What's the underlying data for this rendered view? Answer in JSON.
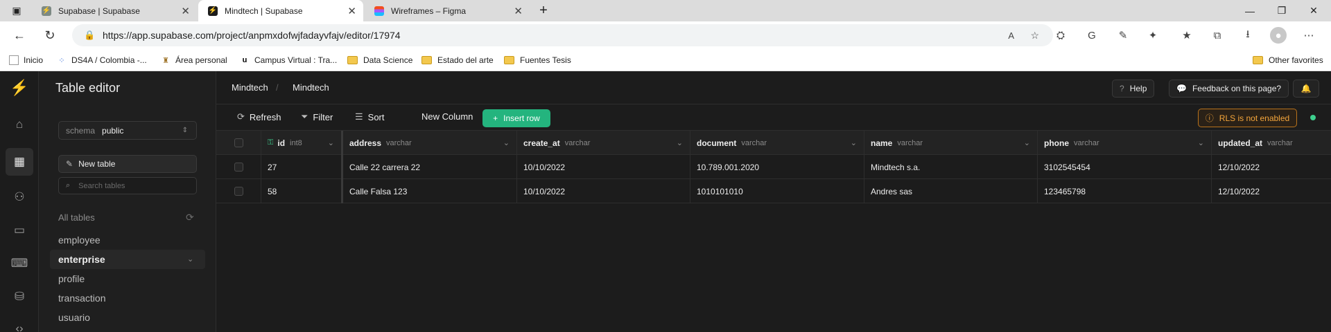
{
  "browser": {
    "tabs": [
      {
        "title": "Supabase | Supabase",
        "icon": "supabase-icon"
      },
      {
        "title": "Mindtech | Supabase",
        "icon": "supabase-icon"
      },
      {
        "title": "Wireframes – Figma",
        "icon": "figma-icon"
      }
    ],
    "url": "https://app.supabase.com/project/anpmxdofwjfadayvfajv/editor/17974",
    "bookmarks": [
      "Inicio",
      "DS4A / Colombia -...",
      "Área personal",
      "Campus Virtual : Tra...",
      "Data Science",
      "Estado del arte",
      "Fuentes Tesis"
    ],
    "other_favorites": "Other favorites"
  },
  "sidebar": {
    "title": "Table editor",
    "schema_label": "schema",
    "schema_value": "public",
    "new_table": "New table",
    "search_placeholder": "Search tables",
    "all_tables": "All tables",
    "tables": [
      "employee",
      "enterprise",
      "profile",
      "transaction",
      "usuario"
    ],
    "active_table": "enterprise"
  },
  "header": {
    "breadcrumb": [
      "Mindtech",
      "Mindtech"
    ],
    "help": "Help",
    "feedback": "Feedback on this page?"
  },
  "toolbar": {
    "refresh": "Refresh",
    "filter": "Filter",
    "sort": "Sort",
    "new_column": "New Column",
    "insert_row": "Insert row",
    "rls_warning": "RLS is not enabled"
  },
  "grid": {
    "columns": [
      {
        "name": "id",
        "type": "int8"
      },
      {
        "name": "address",
        "type": "varchar"
      },
      {
        "name": "create_at",
        "type": "varchar"
      },
      {
        "name": "document",
        "type": "varchar"
      },
      {
        "name": "name",
        "type": "varchar"
      },
      {
        "name": "phone",
        "type": "varchar"
      },
      {
        "name": "updated_at",
        "type": "varchar"
      }
    ],
    "rows": [
      [
        "27",
        "Calle 22 carrera 22",
        "10/10/2022",
        "10.789.001.2020",
        "Mindtech s.a.",
        "3102545454",
        "12/10/2022"
      ],
      [
        "58",
        "Calle Falsa 123",
        "10/10/2022",
        "1010101010",
        "Andres sas",
        "123465798",
        "12/10/2022"
      ]
    ]
  },
  "colors": {
    "accent": "#24b47e",
    "warning": "#f4a53b",
    "background": "#1c1c1c"
  }
}
